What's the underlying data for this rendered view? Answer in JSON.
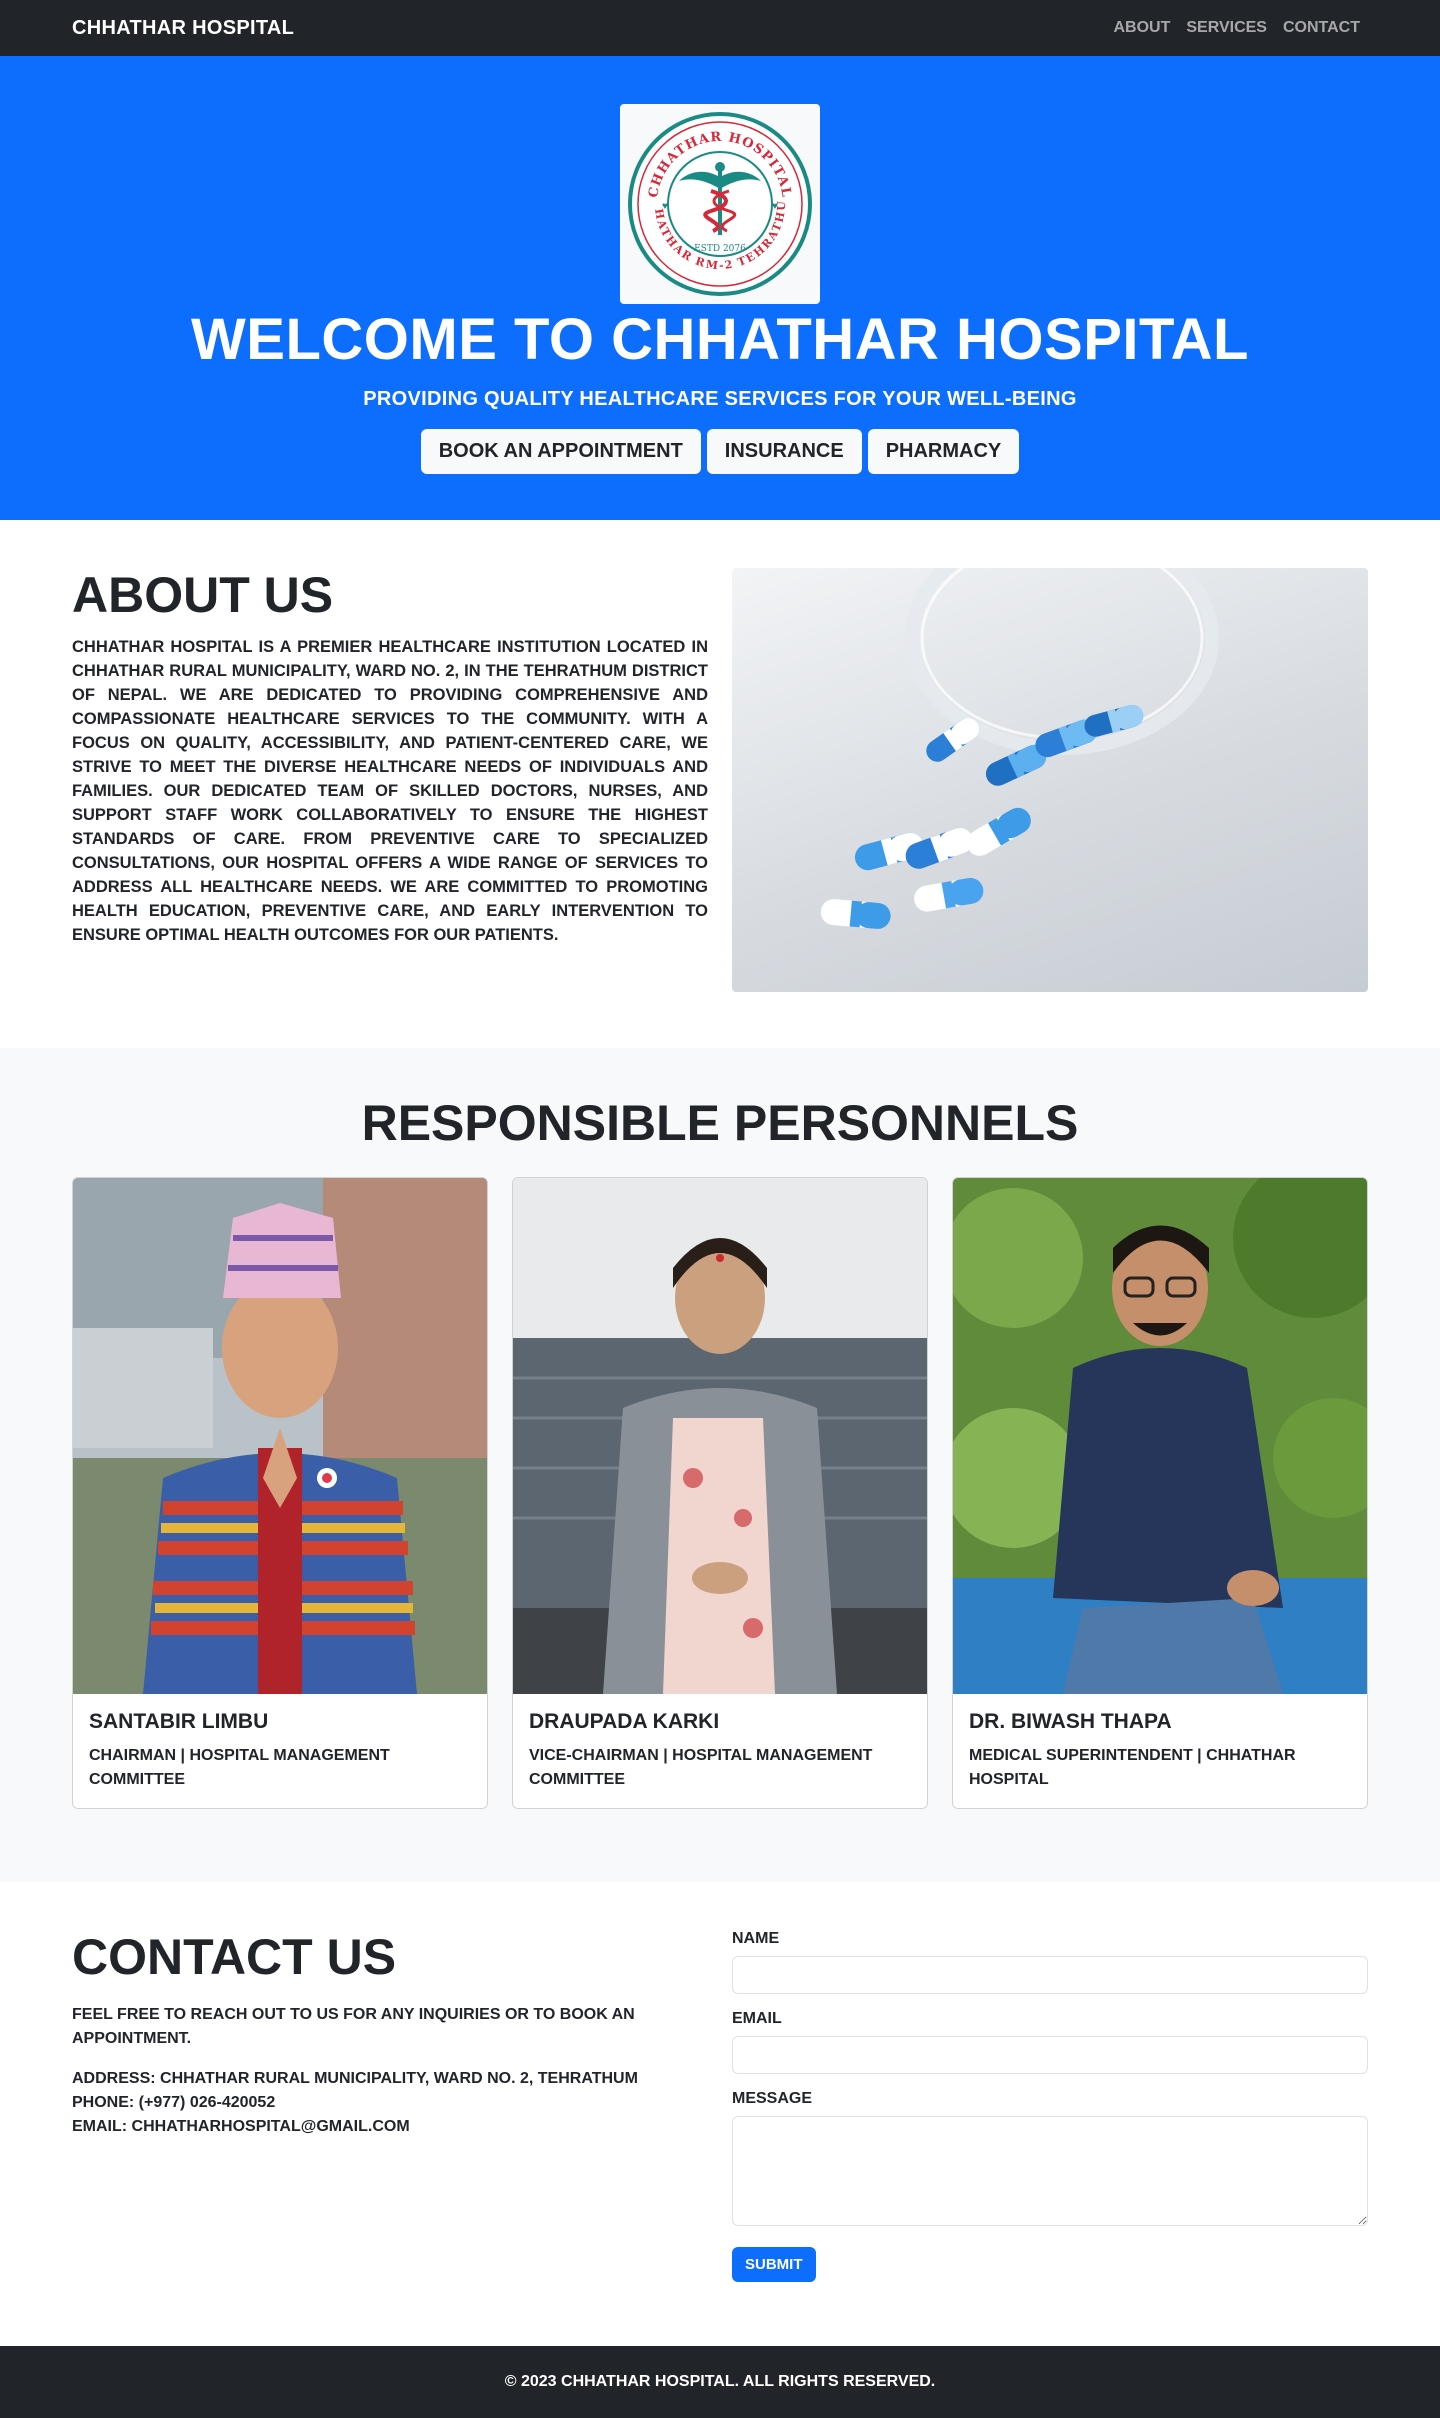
{
  "navbar": {
    "brand": "CHHATHAR HOSPITAL",
    "links": [
      "ABOUT",
      "SERVICES",
      "CONTACT"
    ]
  },
  "hero": {
    "logo": {
      "top_text": "CHHATHAR HOSPITAL",
      "bottom_text": "CHHATHAR RM-2 TEHRATHUM",
      "estd": "ESTD 2076",
      "icon": "caduceus-icon"
    },
    "title": "WELCOME TO CHHATHAR HOSPITAL",
    "subtitle": "PROVIDING QUALITY HEALTHCARE SERVICES FOR YOUR WELL-BEING",
    "buttons": [
      "BOOK AN APPOINTMENT",
      "INSURANCE",
      "PHARMACY"
    ]
  },
  "about": {
    "title": "ABOUT US",
    "text": "CHHATHAR HOSPITAL IS A PREMIER HEALTHCARE INSTITUTION LOCATED IN CHHATHAR RURAL MUNICIPALITY, WARD NO. 2, IN THE TEHRATHUM DISTRICT OF NEPAL. WE ARE DEDICATED TO PROVIDING COMPREHENSIVE AND COMPASSIONATE HEALTHCARE SERVICES TO THE COMMUNITY. WITH A FOCUS ON QUALITY, ACCESSIBILITY, AND PATIENT-CENTERED CARE, WE STRIVE TO MEET THE DIVERSE HEALTHCARE NEEDS OF INDIVIDUALS AND FAMILIES. OUR DEDICATED TEAM OF SKILLED DOCTORS, NURSES, AND SUPPORT STAFF WORK COLLABORATIVELY TO ENSURE THE HIGHEST STANDARDS OF CARE. FROM PREVENTIVE CARE TO SPECIALIZED CONSULTATIONS, OUR HOSPITAL OFFERS A WIDE RANGE OF SERVICES TO ADDRESS ALL HEALTHCARE NEEDS. WE ARE COMMITTED TO PROMOTING HEALTH EDUCATION, PREVENTIVE CARE, AND EARLY INTERVENTION TO ENSURE OPTIMAL HEALTH OUTCOMES FOR OUR PATIENTS."
  },
  "personnel": {
    "title": "RESPONSIBLE PERSONNELS",
    "people": [
      {
        "name": "SANTABIR LIMBU",
        "role": "CHAIRMAN | HOSPITAL MANAGEMENT COMMITTEE"
      },
      {
        "name": "DRAUPADA KARKI",
        "role": "VICE-CHAIRMAN | HOSPITAL MANAGEMENT COMMITTEE"
      },
      {
        "name": "DR. BIWASH THAPA",
        "role": "MEDICAL SUPERINTENDENT | CHHATHAR HOSPITAL"
      }
    ]
  },
  "contact": {
    "title": "CONTACT US",
    "intro": "FEEL FREE TO REACH OUT TO US FOR ANY INQUIRIES OR TO BOOK AN APPOINTMENT.",
    "address": "ADDRESS: CHHATHAR RURAL MUNICIPALITY, WARD NO. 2, TEHRATHUM",
    "phone": "PHONE: (+977) 026-420052",
    "email": "EMAIL: CHHATHARHOSPITAL@GMAIL.COM",
    "form": {
      "name_label": "NAME",
      "name_value": "",
      "email_label": "EMAIL",
      "email_value": "",
      "message_label": "MESSAGE",
      "message_value": "",
      "submit": "SUBMIT"
    }
  },
  "footer": {
    "text": "© 2023 CHHATHAR HOSPITAL. ALL RIGHTS RESERVED."
  },
  "colors": {
    "primary": "#0d6efd",
    "dark": "#212529",
    "light": "#f8f9fa",
    "logo_red": "#d62839",
    "logo_teal": "#1a8a85"
  }
}
